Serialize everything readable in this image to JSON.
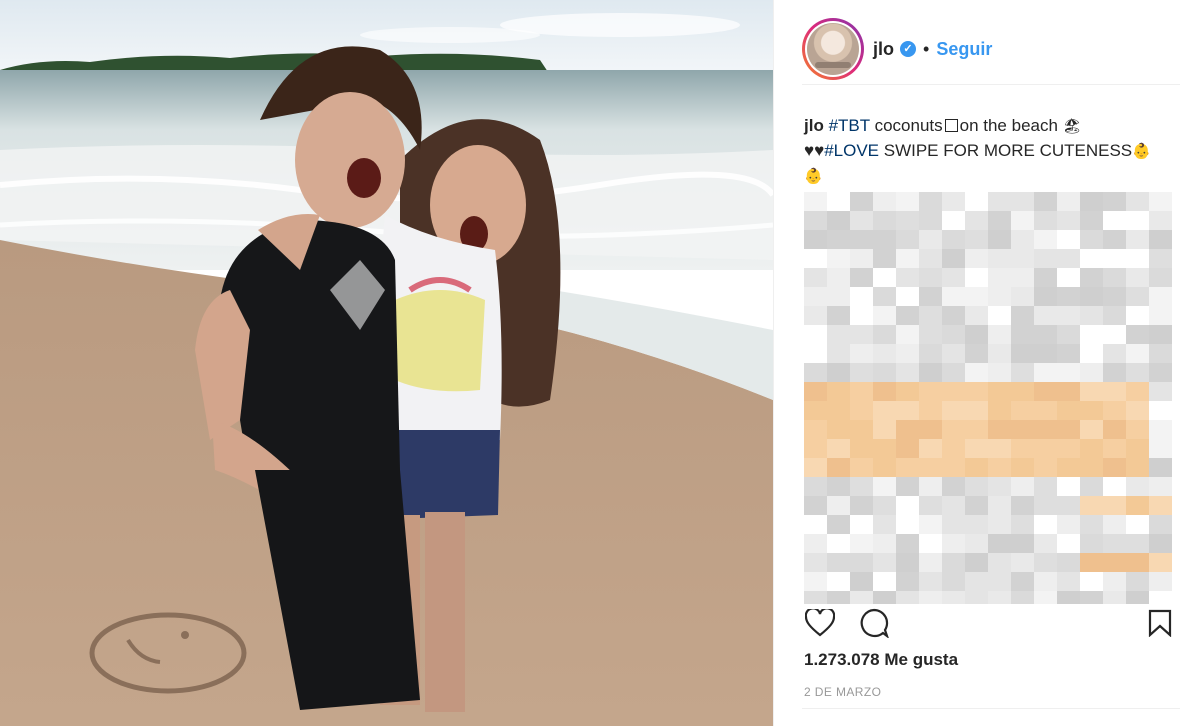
{
  "profile": {
    "username": "jlo",
    "separator": "•",
    "follow_label": "Seguir",
    "verified_icon": "verified-badge-icon",
    "ring_colors": [
      "#f58529",
      "#dd2a7b",
      "#8134af"
    ]
  },
  "caption": {
    "author": "jlo",
    "hashtag1": "#TBT",
    "text1": "coconuts",
    "box_icon": "square-symbol",
    "text2": "on the beach",
    "emoji_beach": "🏖",
    "hearts": "♥♥",
    "hashtag2": "#LOVE",
    "text3": "SWIPE FOR MORE CUTENESS",
    "emoji_baby": "👶",
    "emoji_baby2": "👶"
  },
  "comments_pixelated": true,
  "actions": {
    "like_icon": "heart-icon",
    "comment_icon": "comment-bubble-icon",
    "save_icon": "bookmark-icon"
  },
  "likes_text": "1.273.078 Me gusta",
  "date_text": "2 DE MARZO",
  "colors": {
    "link": "#3897f0",
    "hashtag": "#003569",
    "text": "#262626",
    "muted": "#999999"
  }
}
